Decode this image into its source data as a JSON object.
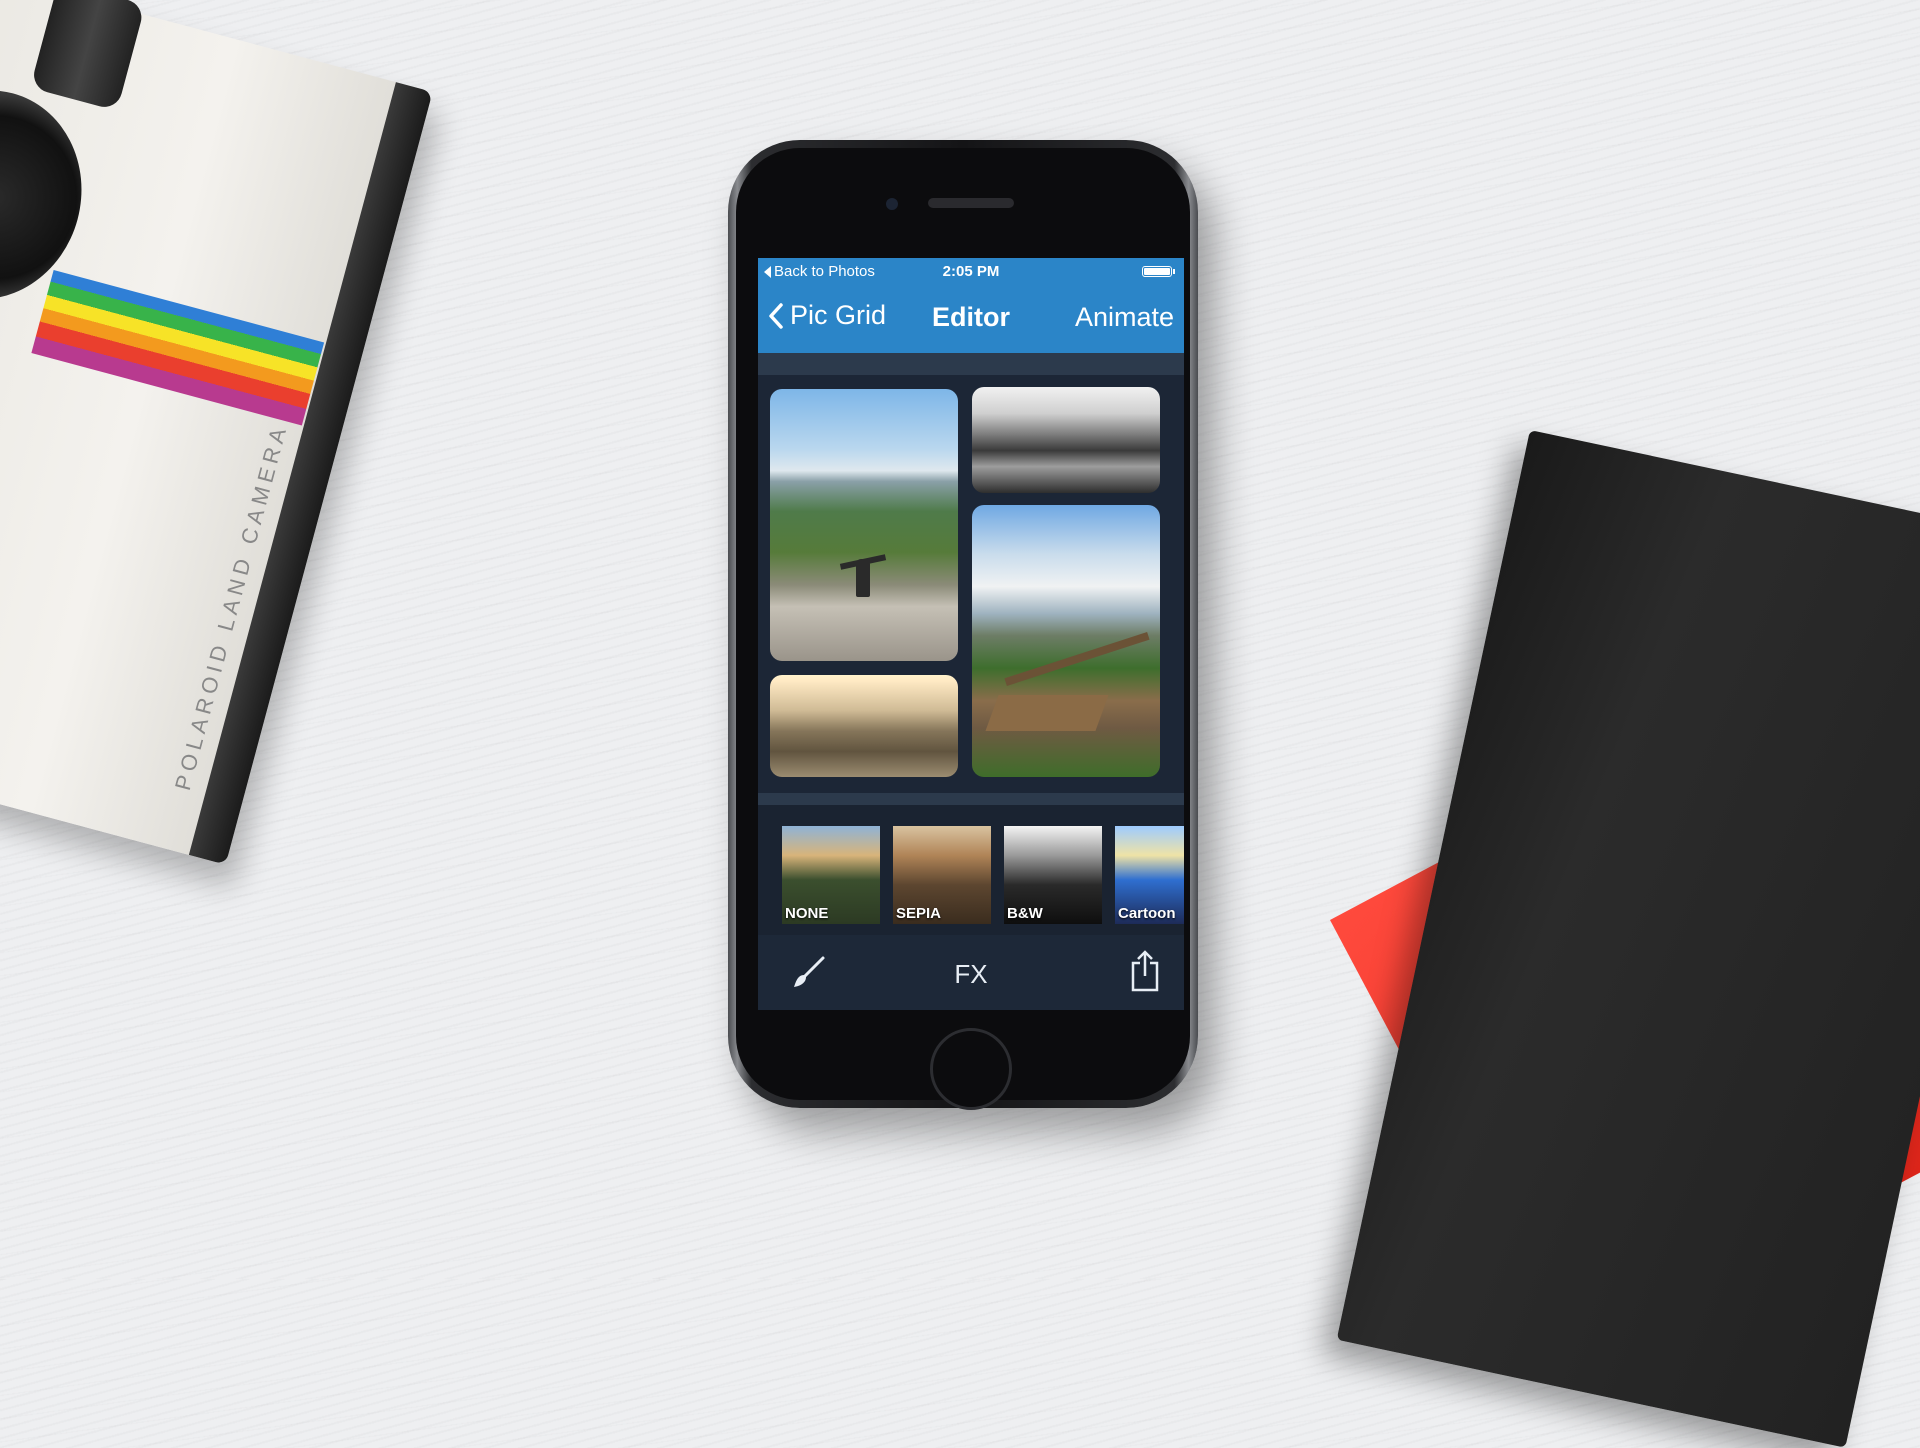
{
  "background": {
    "camera_text": "POLAROID LAND CAMERA"
  },
  "app": {
    "status_bar": {
      "back_label": "Back to Photos",
      "time": "2:05 PM",
      "battery": "full"
    },
    "nav": {
      "back_label": "Pic Grid",
      "title": "Editor",
      "right_action": "Animate",
      "bar_color": "#2b85c8"
    },
    "grid": {
      "tiles": [
        {
          "name": "mountain-hiker-photo",
          "style": "color"
        },
        {
          "name": "mountain-valley-photo",
          "style": "black-and-white"
        },
        {
          "name": "wooden-bridge-photo",
          "style": "color"
        },
        {
          "name": "resting-feet-photo",
          "style": "sepia"
        }
      ]
    },
    "filters": [
      {
        "label": "NONE"
      },
      {
        "label": "SEPIA"
      },
      {
        "label": "B&W"
      },
      {
        "label": "Cartoon"
      }
    ],
    "toolbar": {
      "brush_icon": "brush-icon",
      "center_label": "FX",
      "share_icon": "share-icon"
    }
  }
}
